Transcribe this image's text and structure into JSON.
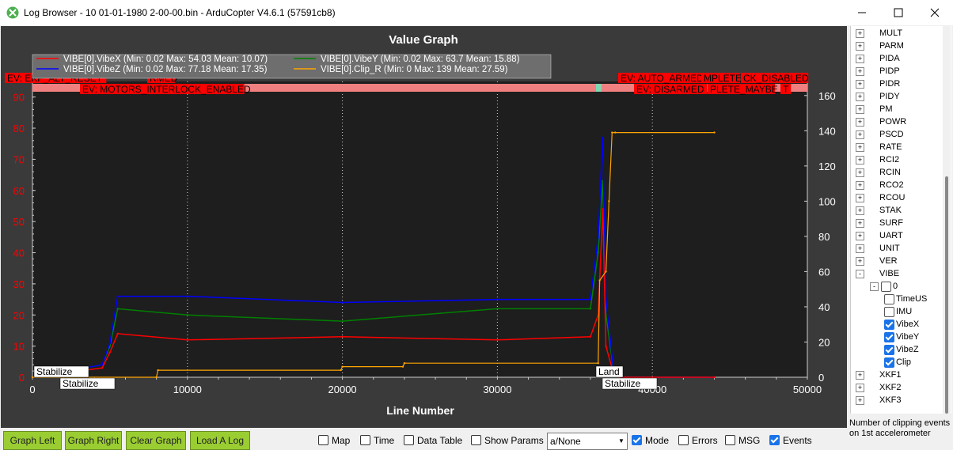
{
  "window": {
    "title": "Log Browser - 10 01-01-1980 2-00-00.bin - ArduCopter V4.6.1 (57591cb8)"
  },
  "colors": {
    "vibe_x": "#ff0000",
    "vibe_y": "#008000",
    "vibe_z": "#0000ff",
    "clip": "#ffa500",
    "left_axis_text": "#ff0000",
    "button_green": "#9acd32"
  },
  "chart_data": {
    "type": "line",
    "title": "Value Graph",
    "xlabel": "Line Number",
    "xlim": [
      0,
      50000
    ],
    "x_ticks": [
      "0",
      "10000",
      "20000",
      "30000",
      "40000",
      "50000"
    ],
    "ylim_left": [
      0,
      95
    ],
    "y_ticks_left": [
      "0",
      "10",
      "20",
      "30",
      "40",
      "50",
      "60",
      "70",
      "80",
      "90"
    ],
    "ylim_right": [
      0,
      168
    ],
    "y_ticks_right": [
      "0",
      "20",
      "40",
      "60",
      "80",
      "100",
      "120",
      "140",
      "160"
    ],
    "grid": true,
    "legend_position": "top-left",
    "legend": [
      "VIBE[0].VibeX  (Min: 0.02 Max: 54.03 Mean: 10.07)",
      "VIBE[0].VibeY  (Min: 0.02 Max: 63.7 Mean: 15.88)",
      "VIBE[0].VibeZ  (Min: 0.02 Max: 77.18 Mean: 17.35)",
      "VIBE[0].Clip_R  (Min: 0 Max: 139 Mean: 27.59)"
    ],
    "series": [
      {
        "name": "VIBE[0].VibeX",
        "axis": "left",
        "x": [
          0,
          4500,
          5000,
          5500,
          10000,
          20000,
          30000,
          36000,
          36500,
          36800,
          37000,
          37500,
          38000,
          40000,
          44000
        ],
        "values": [
          0,
          3,
          8,
          14,
          12,
          13,
          12,
          13,
          20,
          54,
          10,
          1,
          0,
          0,
          0
        ]
      },
      {
        "name": "VIBE[0].VibeY",
        "axis": "left",
        "x": [
          0,
          4500,
          5000,
          5500,
          10000,
          20000,
          30000,
          36000,
          36500,
          36800,
          37000,
          37500,
          38000,
          40000,
          44000
        ],
        "values": [
          0,
          4,
          10,
          22,
          20,
          18,
          22,
          22,
          40,
          63,
          20,
          2,
          0,
          0,
          0
        ]
      },
      {
        "name": "VIBE[0].VibeZ",
        "axis": "left",
        "x": [
          0,
          4500,
          5000,
          5500,
          10000,
          20000,
          30000,
          36000,
          36500,
          36800,
          37000,
          37500,
          38000,
          40000,
          44000
        ],
        "values": [
          0,
          4,
          11,
          26,
          26,
          24,
          25,
          25,
          45,
          77,
          25,
          2,
          0,
          0,
          0
        ]
      },
      {
        "name": "VIBE[0].Clip_R",
        "axis": "right",
        "x": [
          0,
          8000,
          8100,
          19900,
          20000,
          23900,
          24000,
          36500,
          36600,
          37000,
          37200,
          37400,
          37600,
          44000
        ],
        "values": [
          0,
          0,
          4,
          4,
          6,
          6,
          8,
          8,
          55,
          60,
          100,
          139,
          139,
          139
        ]
      }
    ],
    "event_markers": {
      "top_labels": [
        {
          "text": "EV: EKF_ALT_RESET",
          "x": 5,
          "lane": 0
        },
        {
          "text": "RMED",
          "x": 185,
          "lane": 0
        },
        {
          "text": "EV: MOTORS_INTERLOCK_ENABLED",
          "x": 100,
          "lane": 1
        },
        {
          "text": "EV: AUTO_ARMED",
          "x": 780,
          "lane": 0
        },
        {
          "text": "MPLETE",
          "x": 885,
          "lane": 0
        },
        {
          "text": "CK_DISABLED",
          "x": 935,
          "lane": 0
        },
        {
          "text": "EV: DISARMED",
          "x": 800,
          "lane": 1
        },
        {
          "text": "PLETE_MAYBE",
          "x": 893,
          "lane": 1
        },
        {
          "text": "T",
          "x": 985,
          "lane": 1
        }
      ],
      "mode_labels": [
        {
          "text": "Stabilize",
          "x": 42,
          "lane": 0
        },
        {
          "text": "Stabilize",
          "x": 75,
          "lane": 1
        },
        {
          "text": "Land",
          "x": 752,
          "lane": 0
        },
        {
          "text": "Stabilize",
          "x": 760,
          "lane": 1
        }
      ]
    }
  },
  "tree": {
    "items": [
      {
        "label": "MULT",
        "expander": "+"
      },
      {
        "label": "PARM",
        "expander": "+"
      },
      {
        "label": "PIDA",
        "expander": "+"
      },
      {
        "label": "PIDP",
        "expander": "+"
      },
      {
        "label": "PIDR",
        "expander": "+"
      },
      {
        "label": "PIDY",
        "expander": "+"
      },
      {
        "label": "PM",
        "expander": "+"
      },
      {
        "label": "POWR",
        "expander": "+"
      },
      {
        "label": "PSCD",
        "expander": "+"
      },
      {
        "label": "RATE",
        "expander": "+"
      },
      {
        "label": "RCI2",
        "expander": "+"
      },
      {
        "label": "RCIN",
        "expander": "+"
      },
      {
        "label": "RCO2",
        "expander": "+"
      },
      {
        "label": "RCOU",
        "expander": "+"
      },
      {
        "label": "STAK",
        "expander": "+"
      },
      {
        "label": "SURF",
        "expander": "+"
      },
      {
        "label": "UART",
        "expander": "+"
      },
      {
        "label": "UNIT",
        "expander": "+"
      },
      {
        "label": "VER",
        "expander": "+"
      },
      {
        "label": "VIBE",
        "expander": "-"
      },
      {
        "label": "0",
        "expander": "-",
        "checked": false
      },
      {
        "label": "TimeUS",
        "checked": false
      },
      {
        "label": "IMU",
        "checked": false
      },
      {
        "label": "VibeX",
        "checked": true
      },
      {
        "label": "VibeY",
        "checked": true
      },
      {
        "label": "VibeZ",
        "checked": true
      },
      {
        "label": "Clip",
        "checked": true
      },
      {
        "label": "XKF1",
        "expander": "+"
      },
      {
        "label": "XKF2",
        "expander": "+"
      },
      {
        "label": "XKF3",
        "expander": "+"
      }
    ],
    "description": "Number of clipping events on 1st accelerometer"
  },
  "bottom": {
    "buttons": [
      "Graph Left",
      "Graph Right",
      "Clear Graph",
      "Load A Log"
    ],
    "options": [
      {
        "label": "Map",
        "checked": false
      },
      {
        "label": "Time",
        "checked": false
      },
      {
        "label": "Data Table",
        "checked": false
      },
      {
        "label": "Show Params",
        "checked": false
      },
      {
        "label": "Mode",
        "checked": true
      },
      {
        "label": "Errors",
        "checked": false
      },
      {
        "label": "MSG",
        "checked": false
      },
      {
        "label": "Events",
        "checked": true
      }
    ],
    "combo_value": "a/None"
  }
}
